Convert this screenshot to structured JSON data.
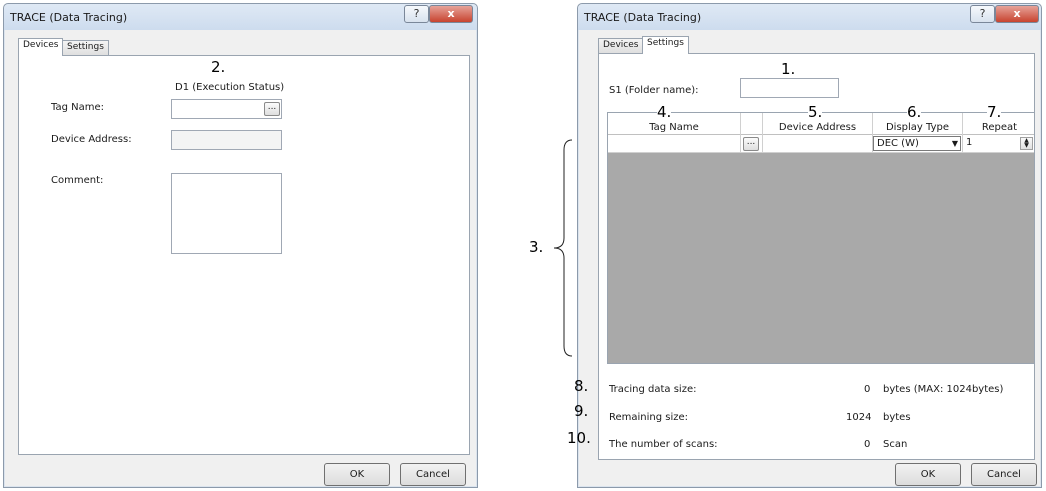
{
  "left_dialog": {
    "title": "TRACE (Data Tracing)",
    "help_glyph": "?",
    "close_glyph": "x",
    "tabs": [
      "Devices",
      "Settings"
    ],
    "active_tab": "Devices",
    "callout": "2.",
    "section_heading": "D1 (Execution Status)",
    "tag_name_label": "Tag Name:",
    "tag_name_value": "",
    "ellipsis": "...",
    "device_address_label": "Device Address:",
    "device_address_value": "",
    "comment_label": "Comment:",
    "comment_value": "",
    "ok_label": "OK",
    "cancel_label": "Cancel"
  },
  "right_dialog": {
    "title": "TRACE (Data Tracing)",
    "help_glyph": "?",
    "close_glyph": "x",
    "tabs": [
      "Devices",
      "Settings"
    ],
    "active_tab": "Settings",
    "folder_label": "S1 (Folder name):",
    "folder_value": "",
    "callouts": {
      "c1": "1.",
      "c3": "3.",
      "c4": "4.",
      "c5": "5.",
      "c6": "6.",
      "c7": "7.",
      "c8": "8.",
      "c9": "9.",
      "c10": "10."
    },
    "table": {
      "columns": [
        "Tag Name",
        "",
        "Device Address",
        "Display Type",
        "Repeat"
      ],
      "row": {
        "tag_name": "",
        "ellipsis": "...",
        "device_address": "",
        "display_type": "DEC (W)",
        "dropdown_glyph": "▼",
        "repeat": "1"
      }
    },
    "stats": [
      {
        "label": "Tracing data size:",
        "value": "0",
        "unit": "bytes (MAX: 1024bytes)"
      },
      {
        "label": "Remaining size:",
        "value": "1024",
        "unit": "bytes"
      },
      {
        "label": "The number of scans:",
        "value": "0",
        "unit": "Scan"
      }
    ],
    "ok_label": "OK",
    "cancel_label": "Cancel"
  }
}
